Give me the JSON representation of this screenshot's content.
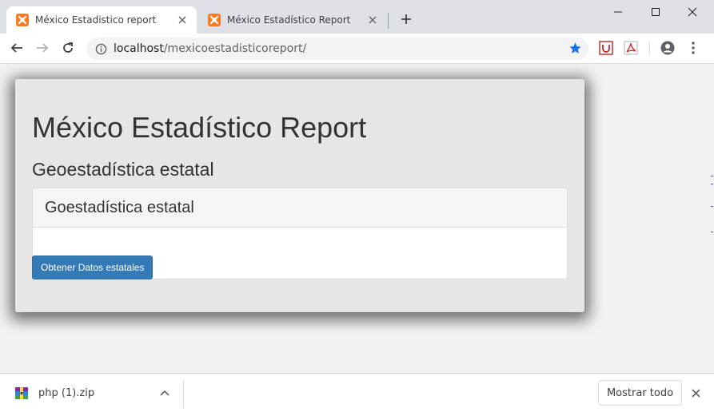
{
  "browser": {
    "tabs": [
      {
        "title": "México Estadistico report",
        "active": true
      },
      {
        "title": "México Estadístico Report",
        "active": false
      }
    ],
    "address": {
      "host": "localhost",
      "path": "/mexicoestadisticoreport/"
    }
  },
  "page": {
    "title": "México Estadístico Report",
    "subtitle": "Geoestadística estatal",
    "panel": {
      "heading": "Goestadística estatal",
      "button_label": "Obtener Datos estatales"
    }
  },
  "downloads": {
    "file_name": "php (1).zip",
    "show_all_label": "Mostrar todo"
  },
  "colors": {
    "primary_button": "#337ab7",
    "jumbotron_bg": "#e8e6e5",
    "favicon": "#fb7a24",
    "star": "#1a73e8"
  }
}
